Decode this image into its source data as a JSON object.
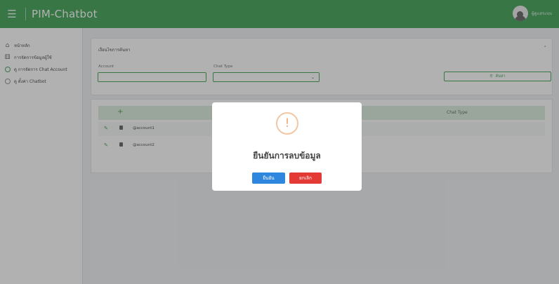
{
  "header": {
    "title": "PIM-Chatbot",
    "menu_icon": "hamburger-icon",
    "user_name": "ผู้ดูแลระบบ"
  },
  "sidebar": {
    "items": [
      {
        "label": "หน้าหลัก",
        "icon": "home-icon"
      },
      {
        "label": "การจัดการข้อมูลผู้ใช้",
        "icon": "users-icon"
      },
      {
        "label": "ดู การจัดการ Chat Account",
        "icon": "chat-icon"
      },
      {
        "label": "ดู ตั้งค่า Chatbot",
        "icon": "chat-icon"
      }
    ]
  },
  "search": {
    "title": "เงื่อนไขการค้นหา",
    "account_label": "Account",
    "account_value": "",
    "chat_type_label": "Chat Type",
    "chat_type_value": "",
    "search_button": "ค้นหา"
  },
  "table": {
    "add_symbol": "+",
    "columns": [
      "",
      "Chat Type"
    ],
    "rows": [
      {
        "account": "@account1"
      },
      {
        "account": "@account2"
      }
    ]
  },
  "modal": {
    "icon_symbol": "!",
    "title": "ยืนยันการลบข้อมูล",
    "confirm_label": "ยืนยัน",
    "cancel_label": "ยกเลิก"
  },
  "colors": {
    "brand": "#2f9a46",
    "confirm": "#2e86de",
    "cancel": "#e33a35",
    "warning": "#efa874"
  }
}
